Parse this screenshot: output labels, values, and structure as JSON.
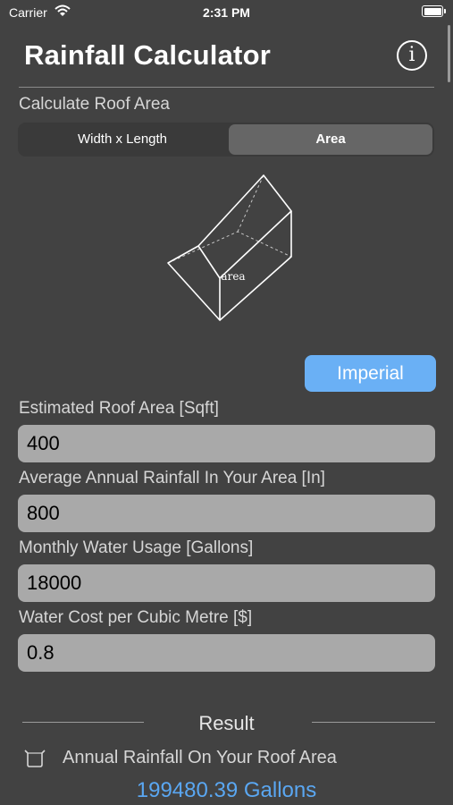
{
  "status_bar": {
    "carrier": "Carrier",
    "time": "2:31 PM"
  },
  "header": {
    "title": "Rainfall Calculator",
    "info_icon": "info-icon"
  },
  "roof_section": {
    "label": "Calculate Roof Area",
    "segments": [
      {
        "label": "Width x Length",
        "selected": false
      },
      {
        "label": "Area",
        "selected": true
      }
    ],
    "diagram_label": "area"
  },
  "units_button": {
    "label": "Imperial",
    "color": "#6ab0f5"
  },
  "fields": [
    {
      "label": "Estimated Roof Area [Sqft]",
      "value": "400"
    },
    {
      "label": "Average Annual Rainfall In Your Area [In]",
      "value": "800"
    },
    {
      "label": "Monthly Water Usage [Gallons]",
      "value": "18000"
    },
    {
      "label": "Water Cost per Cubic Metre [$]",
      "value": "0.8"
    }
  ],
  "result": {
    "title": "Result",
    "items": [
      {
        "icon": "bucket-icon",
        "label": "Annual Rainfall On Your Roof Area",
        "value": "199480.39 Gallons"
      }
    ]
  },
  "colors": {
    "background": "#424242",
    "accent": "#5aa7f2",
    "field": "#a9a9a9"
  }
}
